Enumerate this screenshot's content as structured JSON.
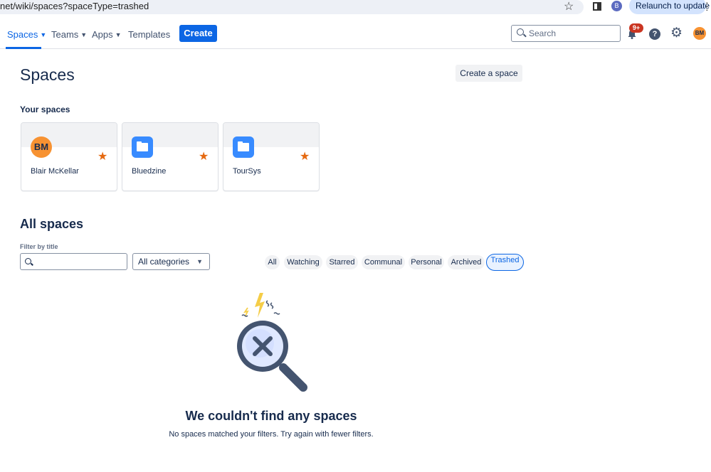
{
  "browser": {
    "url": "net/wiki/spaces?spaceType=trashed",
    "profile_initial": "B",
    "relaunch_label": "Relaunch to update"
  },
  "nav": {
    "spaces_label": "Spaces",
    "teams_label": "Teams",
    "apps_label": "Apps",
    "templates_label": "Templates",
    "create_label": "Create",
    "search_placeholder": "Search",
    "notification_badge": "9+",
    "help_glyph": "?",
    "avatar_initials": "BM"
  },
  "page": {
    "title": "Spaces",
    "create_space_label": "Create a space",
    "your_spaces_heading": "Your spaces"
  },
  "your_spaces": [
    {
      "name": "Blair McKellar",
      "icon": "avatar",
      "initials": "BM",
      "starred": true
    },
    {
      "name": "Bluedzine",
      "icon": "folder-icon",
      "starred": true
    },
    {
      "name": "TourSys",
      "icon": "folder-icon",
      "starred": true
    }
  ],
  "all_spaces": {
    "heading": "All spaces",
    "filter_label": "Filter by title",
    "filter_value": "",
    "category_selected": "All categories",
    "filters": [
      {
        "label": "All",
        "active": false
      },
      {
        "label": "Watching",
        "active": false
      },
      {
        "label": "Starred",
        "active": false
      },
      {
        "label": "Communal",
        "active": false
      },
      {
        "label": "Personal",
        "active": false
      },
      {
        "label": "Archived",
        "active": false
      },
      {
        "label": "Trashed",
        "active": true
      }
    ]
  },
  "empty_state": {
    "title": "We couldn't find any spaces",
    "description": "No spaces matched your filters. Try again with fewer filters."
  },
  "colors": {
    "brand_blue": "#0c66e4",
    "avatar_orange": "#f79232",
    "star_orange": "#e56910",
    "badge_red": "#ca3521"
  }
}
